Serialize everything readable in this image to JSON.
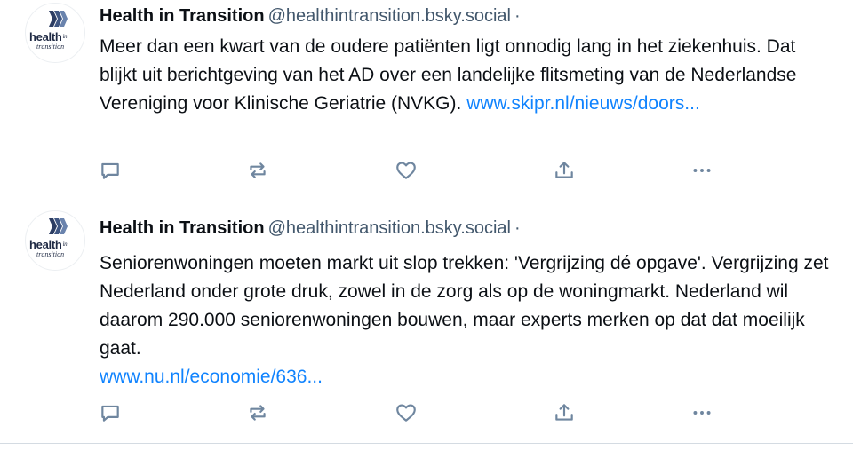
{
  "colors": {
    "text": "#0b0f14",
    "muted": "#42576c",
    "link": "#1083fe",
    "icon": "#6f869f",
    "divider": "#d4dbe2"
  },
  "posts": [
    {
      "avatar": {
        "logo_word": "health",
        "logo_in": "in",
        "logo_sub": "transition"
      },
      "author": "Health in Transition",
      "handle": "@healthintransition.bsky.social",
      "separator": "·",
      "text": "Meer dan een kwart van de oudere patiënten ligt onnodig lang in het ziekenhuis. Dat blijkt uit berichtgeving van het AD over een landelijke flitsmeting van de Nederlandse Vereniging voor Klinische Geriatrie (NVKG).",
      "link": "www.skipr.nl/nieuws/doors...",
      "actions": {
        "reply_icon": "speech-bubble-icon",
        "repost_icon": "repost-arrows-icon",
        "like_icon": "heart-icon",
        "share_icon": "share-upload-icon",
        "more_icon": "more-dots-icon"
      }
    },
    {
      "avatar": {
        "logo_word": "health",
        "logo_in": "in",
        "logo_sub": "transition"
      },
      "author": "Health in Transition",
      "handle": "@healthintransition.bsky.social",
      "separator": "·",
      "text": "Seniorenwoningen moeten markt uit slop trekken: 'Vergrijzing dé opgave'. Vergrijzing zet Nederland onder grote druk, zowel in de zorg als op de woningmarkt. Nederland wil daarom 290.000 seniorenwoningen bouwen, maar experts merken op dat dat moeilijk gaat.",
      "link": "www.nu.nl/economie/636...",
      "actions": {
        "reply_icon": "speech-bubble-icon",
        "repost_icon": "repost-arrows-icon",
        "like_icon": "heart-icon",
        "share_icon": "share-upload-icon",
        "more_icon": "more-dots-icon"
      }
    }
  ]
}
